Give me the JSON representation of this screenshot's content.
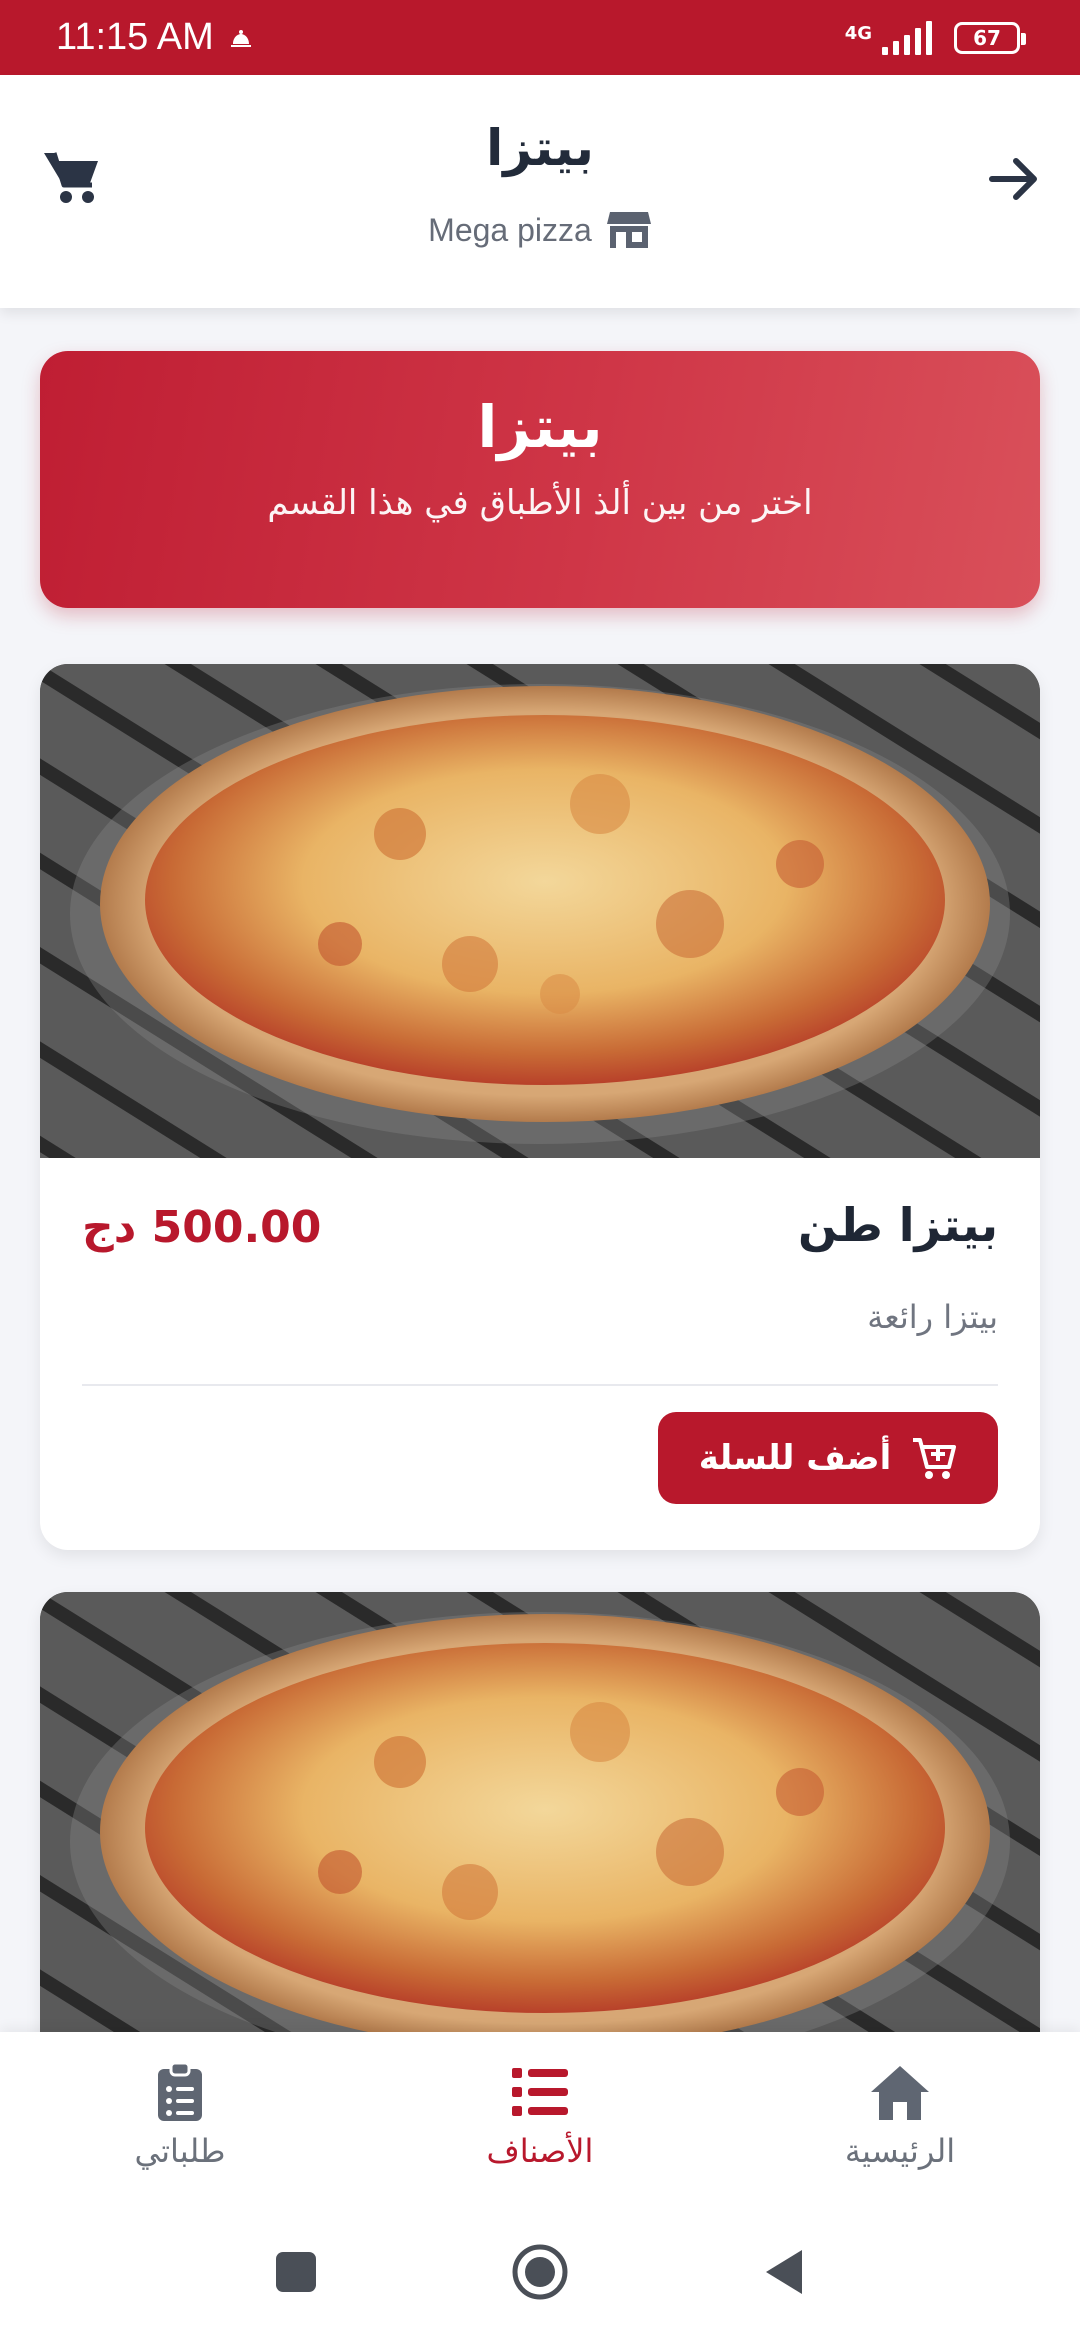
{
  "status_bar": {
    "time": "11:15 AM",
    "network": "4G",
    "battery": "67"
  },
  "header": {
    "title": "بيتزا",
    "store_name": "Mega pizza"
  },
  "banner": {
    "title": "بيتزا",
    "subtitle": "اختر من بين ألذ الأطباق في هذا القسم"
  },
  "products": [
    {
      "name": "بيتزا طن",
      "price": "500.00 دج",
      "description": "بيتزا رائعة",
      "add_label": "أضف للسلة"
    }
  ],
  "bottom_nav": {
    "home": "الرئيسية",
    "categories": "الأصناف",
    "orders": "طلباتي"
  },
  "colors": {
    "brand": "#b8182c",
    "text_dark": "#1f2735",
    "muted": "#6b717b"
  }
}
